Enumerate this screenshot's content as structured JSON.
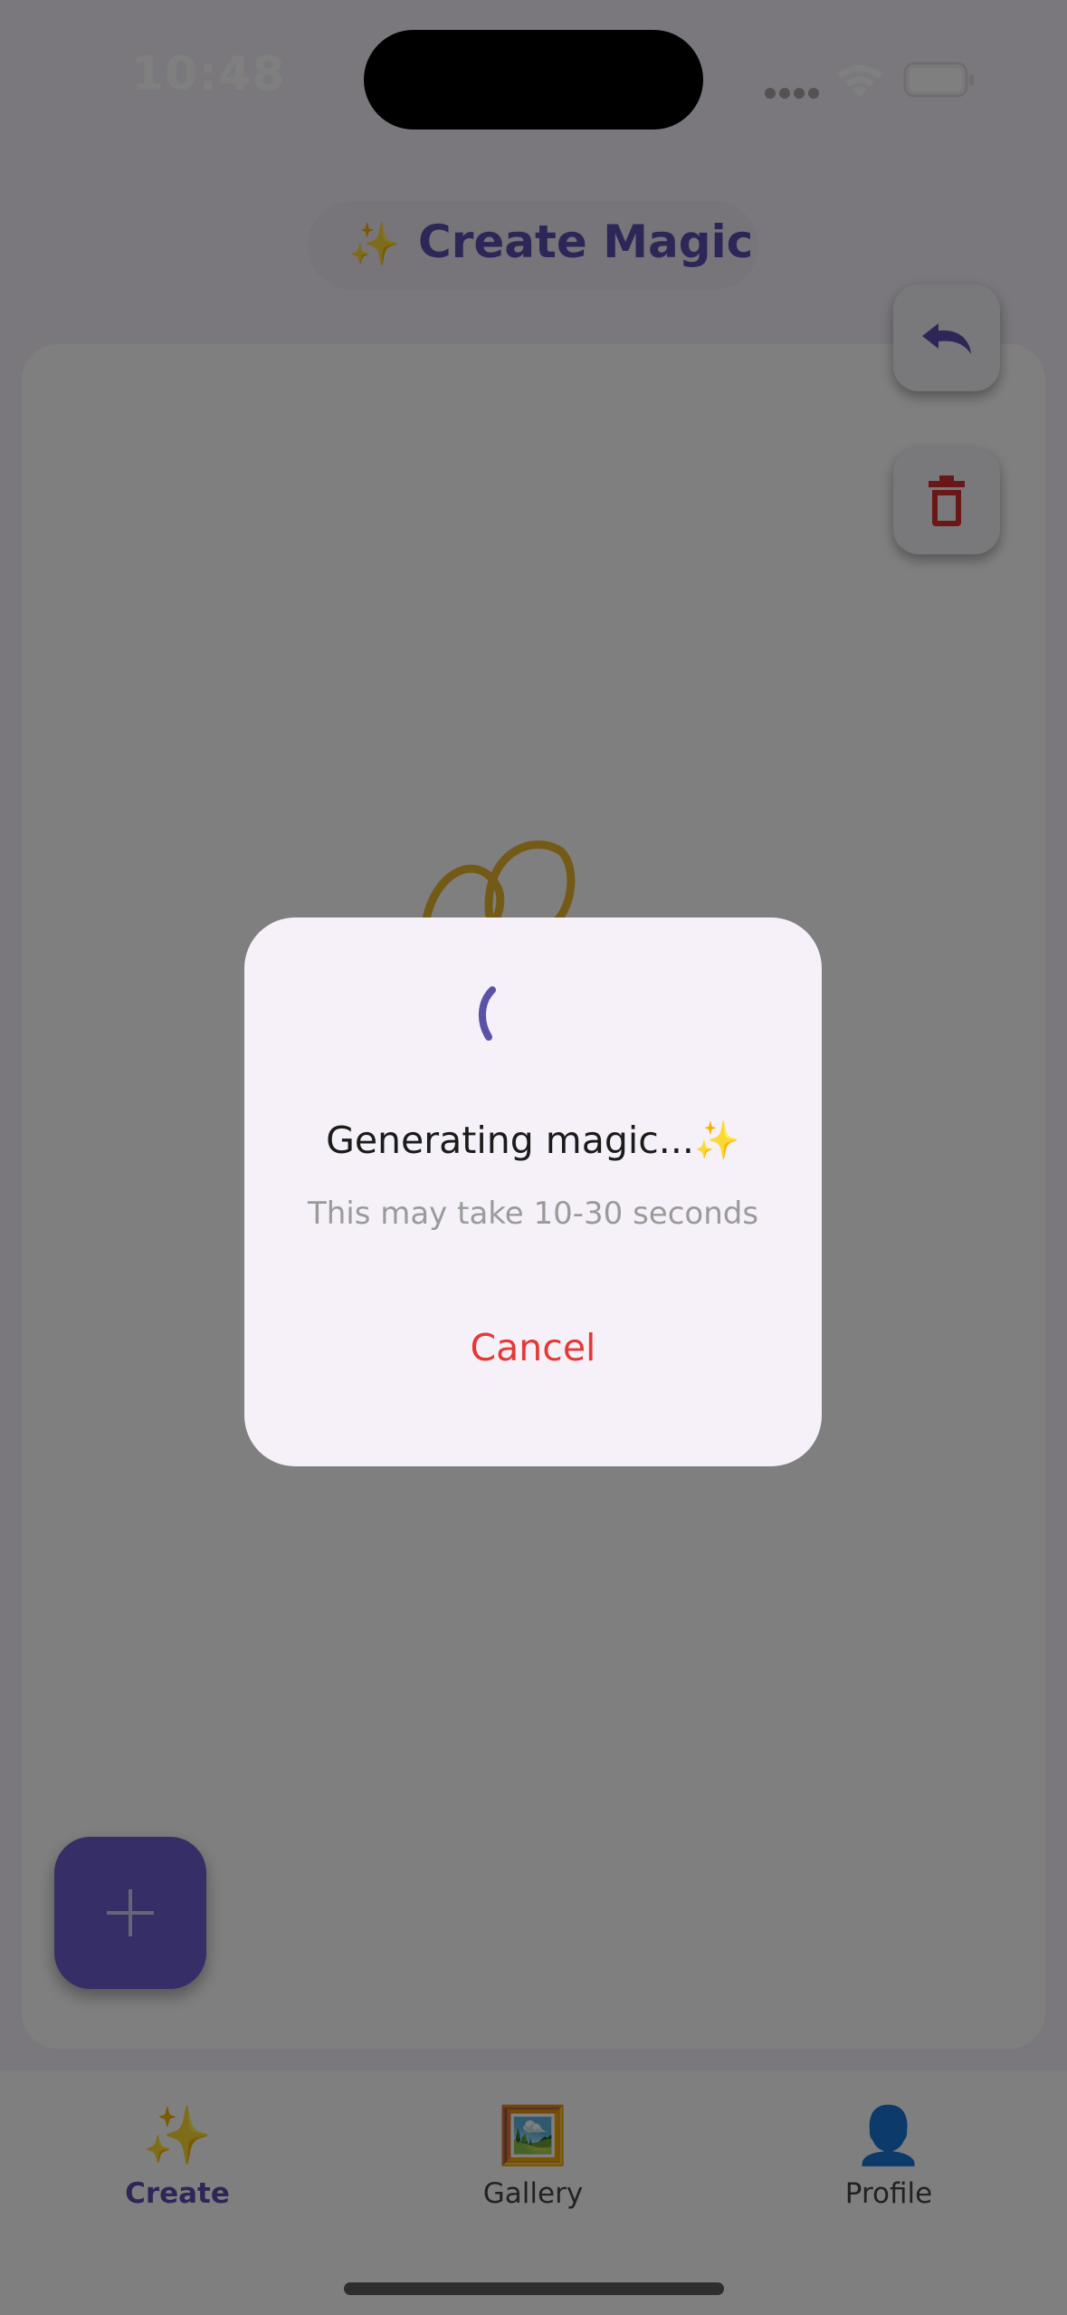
{
  "status_bar": {
    "time": "10:48"
  },
  "header": {
    "icon": "✨",
    "title": "Create Magic"
  },
  "canvas": {
    "undo_icon": "undo-icon",
    "trash_icon": "trash-icon",
    "add_icon": "plus-icon"
  },
  "dialog": {
    "title": "Generating magic...✨",
    "subtitle": "This may take 10-30 seconds",
    "cancel_label": "Cancel"
  },
  "tabs": [
    {
      "label": "Create",
      "icon": "✨",
      "active": true
    },
    {
      "label": "Gallery",
      "icon": "🖼️",
      "active": false
    },
    {
      "label": "Profile",
      "icon": "👤",
      "active": false
    }
  ],
  "colors": {
    "accent": "#6a5ccf",
    "danger": "#e53935",
    "sparkle": "#e7b52d"
  }
}
